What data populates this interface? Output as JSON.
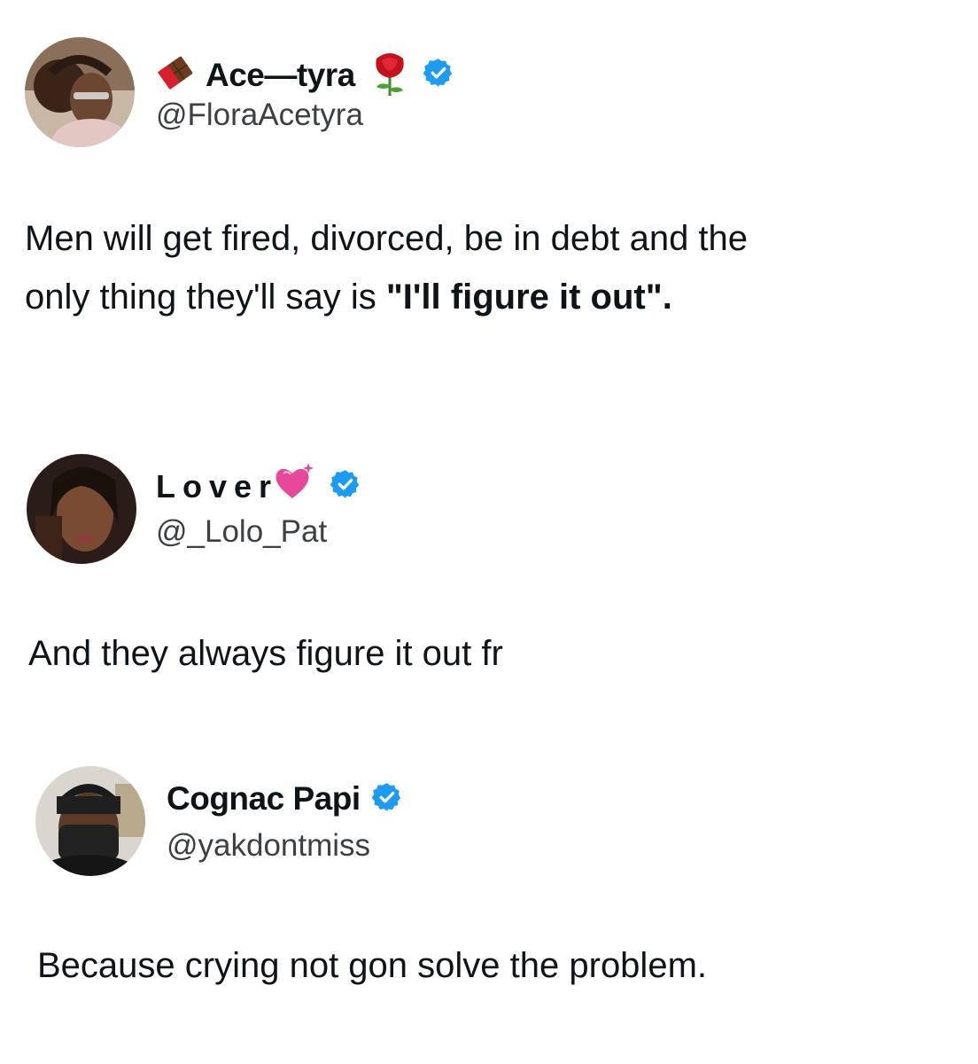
{
  "posts": [
    {
      "display_name": "Ace—tyra",
      "name_prefix_icon": "chocolate-bar-icon",
      "name_suffix_icon": "rose-icon",
      "verified": true,
      "handle": "@FloraAcetyra",
      "text_line1": "Men will get fired, divorced, be in debt and the",
      "text_line2_plain": "only thing they'll say is ",
      "text_line2_bold": "\"I'll figure it out\"."
    },
    {
      "display_name": "Lover",
      "name_suffix_icon": "sparkling-heart-icon",
      "verified": true,
      "handle": "@_Lolo_Pat",
      "text": "And they always figure it out fr"
    },
    {
      "display_name": "Cognac Papi",
      "verified": true,
      "handle": "@yakdontmiss",
      "text": "Because crying not gon solve the problem."
    }
  ],
  "colors": {
    "verified_badge": "#1d9bf0",
    "text": "#0f1419",
    "handle": "#3c4043"
  }
}
